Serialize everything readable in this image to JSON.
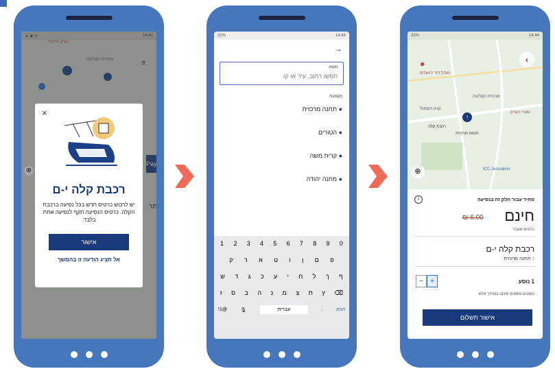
{
  "colors": {
    "phone": "#4677bd",
    "primary": "#183a7a",
    "arrow": "#f26a55",
    "ink": "#1a1a1a",
    "red": "#d93a2f"
  },
  "screen1": {
    "status_right": "14:44",
    "map_labels": [
      "קניון החנות",
      "מרכזית הקליטה",
      "Pay",
      "תר"
    ],
    "popup": {
      "title": "רכבת קלה י-ם",
      "body": "יש לרכוש כרטיס חדש בכל נסיעה ברכבת הקלה. כרטיס הנסיעה תקף לנסיעה אחת בלבד.",
      "confirm": "אישור",
      "dismiss": "אל תציג הודעה זו בהמשך",
      "close": "×"
    }
  },
  "screen2": {
    "status_left": "32%",
    "status_right": "14:44",
    "origin_label": "מוצא",
    "origin_placeholder": "חפשו רחוב, עיר או קו",
    "places_header": "מקומות",
    "places": [
      "תחנה מרכזית",
      "הטורים",
      "קרית משה",
      "מחנה יהודה"
    ],
    "keyboard": {
      "numbers": [
        "1",
        "2",
        "3",
        "4",
        "5",
        "6",
        "7",
        "8",
        "9",
        "0"
      ],
      "row1": [
        "ק",
        "ר",
        "א",
        "ט",
        "ו",
        "ן",
        "ם",
        "פ"
      ],
      "row2": [
        "ש",
        "ד",
        "ג",
        "כ",
        "ע",
        "י",
        "ח",
        "ל",
        "ך",
        "ף"
      ],
      "row3": [
        "ז",
        "ס",
        "ב",
        "ה",
        "נ",
        "מ",
        "צ",
        "ת",
        "ץ"
      ],
      "sym": "!1@",
      "space": "עברית",
      "dot": ".",
      "enter": "הבא"
    }
  },
  "screen3": {
    "status_left": "32%",
    "status_right": "14:44",
    "map_labels": [
      "מגדל דוד ירושלים",
      "מרכזית הקליטה",
      "קניון הקסטל",
      "שערי הצדק",
      "רכבת קלה",
      "תחנה מרכזית",
      "ICC Jerusalem"
    ],
    "price_header": "מחיר עבור חלק זה בנסיעה",
    "price_free": "חינם",
    "price_old": "₪ 6.00",
    "ticket_type": "כרטיס מעבר",
    "route_title": "רכבת קלה י-ם",
    "route_station": "תחנה מרכזית",
    "passengers": "1 נוסע",
    "plus": "+",
    "minus": "−",
    "passengers_note": "נוסעים נוספים יחויבו במחיר מלא",
    "pay_button": "אישור תשלום"
  }
}
